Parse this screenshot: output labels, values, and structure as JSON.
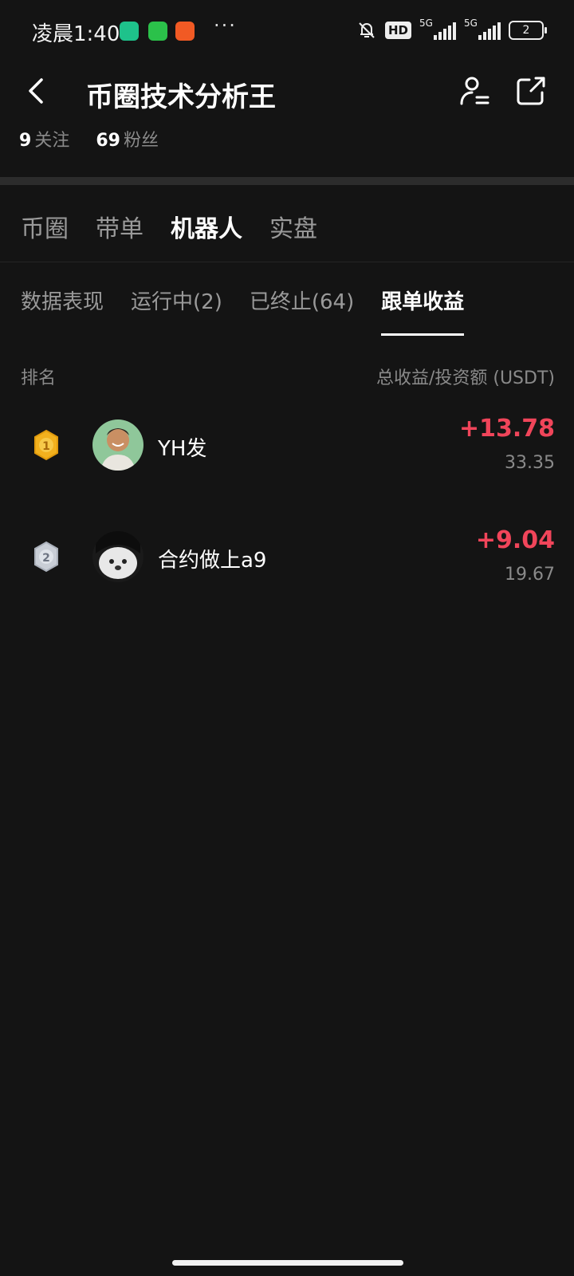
{
  "status_bar": {
    "time": "凌晨1:40",
    "dots": "···",
    "hd_label": "HD",
    "net1": "5G",
    "net2": "5G",
    "battery": "2"
  },
  "header": {
    "title": "币圈技术分析王"
  },
  "stats": {
    "following_count": "9",
    "following_label": "关注",
    "followers_count": "69",
    "followers_label": "粉丝"
  },
  "main_tabs": [
    {
      "label": "币圈",
      "active": false
    },
    {
      "label": "带单",
      "active": false
    },
    {
      "label": "机器人",
      "active": true
    },
    {
      "label": "实盘",
      "active": false
    }
  ],
  "sub_tabs": [
    {
      "label": "数据表现",
      "active": false
    },
    {
      "label": "运行中(2)",
      "active": false
    },
    {
      "label": "已终止(64)",
      "active": false
    },
    {
      "label": "跟单收益",
      "active": true
    }
  ],
  "leaderboard": {
    "col_rank": "排名",
    "col_value": "总收益/投资额 (USDT)",
    "rows": [
      {
        "rank": "1",
        "name": "YH发",
        "profit": "+13.78",
        "investment": "33.35"
      },
      {
        "rank": "2",
        "name": "合约做上a9",
        "profit": "+9.04",
        "investment": "19.67"
      }
    ]
  },
  "colors": {
    "background": "#141414",
    "profit_red": "#f0455a",
    "gold_medal": "#f2b11e",
    "silver_medal": "#c9ced6"
  }
}
